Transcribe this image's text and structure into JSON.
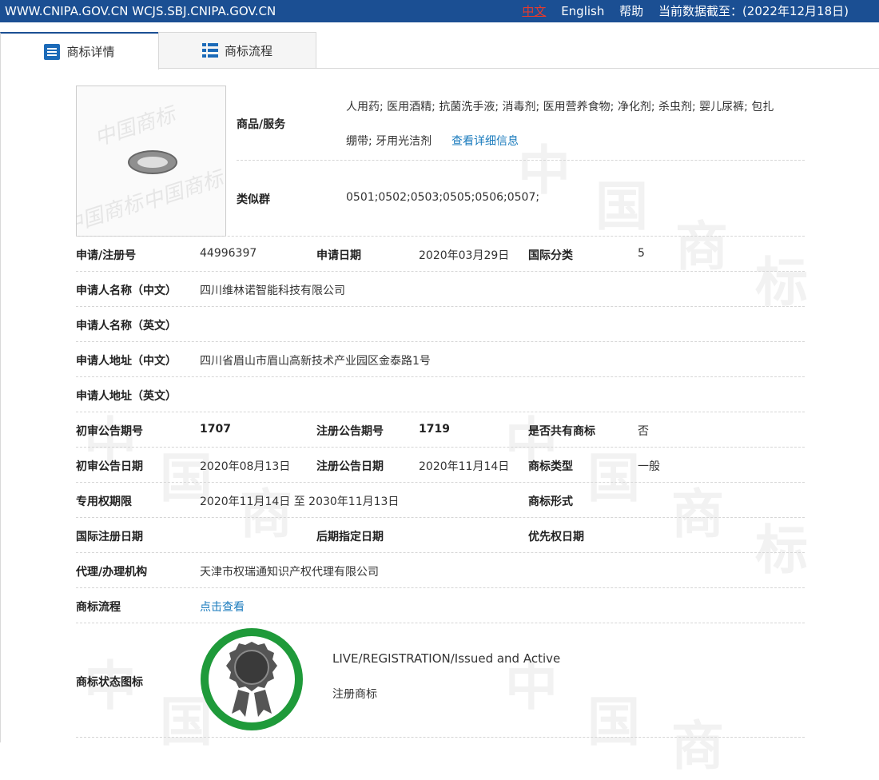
{
  "topbar": {
    "domains": "WWW.CNIPA.GOV.CN WCJS.SBJ.CNIPA.GOV.CN",
    "lang_zh": "中文",
    "lang_en": "English",
    "help": "帮助",
    "data_cutoff": "当前数据截至：(2022年12月18日)"
  },
  "tabs": [
    {
      "label": "商标详情"
    },
    {
      "label": "商标流程"
    }
  ],
  "watermark": [
    "中",
    "国",
    "商",
    "标"
  ],
  "logo_watermark": [
    "中国商标"
  ],
  "goods": {
    "label": "商品/服务",
    "line1": "人用药; 医用酒精; 抗菌洗手液; 消毒剂; 医用营养食物; 净化剂; 杀虫剂; 婴儿尿裤; 包扎",
    "line2": "绷带; 牙用光洁剂",
    "detail_link": "查看详细信息"
  },
  "similar_group": {
    "label": "类似群",
    "value": "0501;0502;0503;0505;0506;0507;"
  },
  "rows": {
    "reg_no": {
      "label": "申请/注册号",
      "value": "44996397"
    },
    "apply_date": {
      "label": "申请日期",
      "value": "2020年03月29日"
    },
    "intl_class": {
      "label": "国际分类",
      "value": "5"
    },
    "applicant_cn": {
      "label": "申请人名称（中文）",
      "value": "四川维林诺智能科技有限公司"
    },
    "applicant_en": {
      "label": "申请人名称（英文）",
      "value": ""
    },
    "address_cn": {
      "label": "申请人地址（中文）",
      "value": "四川省眉山市眉山高新技术产业园区金泰路1号"
    },
    "address_en": {
      "label": "申请人地址（英文）",
      "value": ""
    },
    "prelim_issue": {
      "label": "初审公告期号",
      "value": "1707"
    },
    "reg_issue": {
      "label": "注册公告期号",
      "value": "1719"
    },
    "shared": {
      "label": "是否共有商标",
      "value": "否"
    },
    "prelim_date": {
      "label": "初审公告日期",
      "value": "2020年08月13日"
    },
    "reg_date": {
      "label": "注册公告日期",
      "value": "2020年11月14日"
    },
    "mark_type": {
      "label": "商标类型",
      "value": "一般"
    },
    "exclusive_period": {
      "label": "专用权期限",
      "value": "2020年11月14日 至 2030年11月13日"
    },
    "mark_form": {
      "label": "商标形式",
      "value": ""
    },
    "intl_reg_date": {
      "label": "国际注册日期",
      "value": ""
    },
    "later_designation": {
      "label": "后期指定日期",
      "value": ""
    },
    "priority_date": {
      "label": "优先权日期",
      "value": ""
    },
    "agent": {
      "label": "代理/办理机构",
      "value": "天津市权瑞通知识产权代理有限公司"
    },
    "process": {
      "label": "商标流程",
      "link": "点击查看"
    }
  },
  "status": {
    "label": "商标状态图标",
    "line1": "LIVE/REGISTRATION/Issued and Active",
    "line2": "注册商标",
    "colors": {
      "ring": "#1f9a3a",
      "seal": "#555555"
    }
  }
}
